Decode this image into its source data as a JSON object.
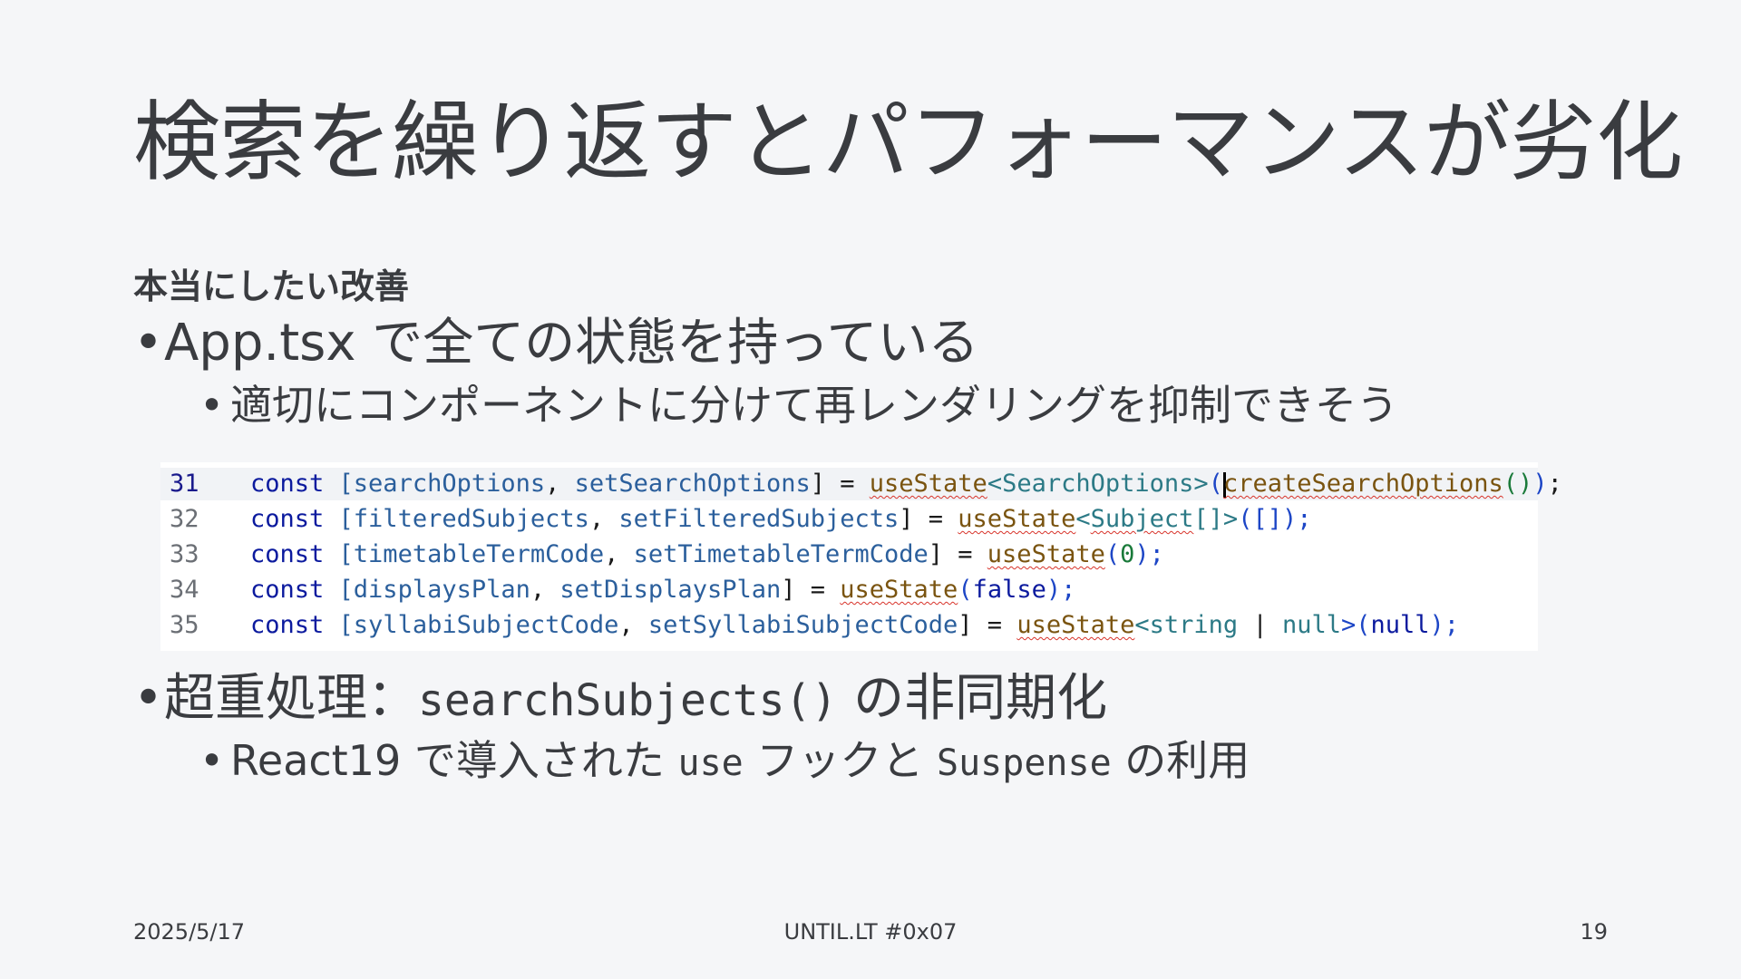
{
  "slide": {
    "title": "検索を繰り返すとパフォーマンスが劣化",
    "subtitle": "本当にしたい改善",
    "bullets": [
      {
        "text": "App.tsx で全ての状態を持っている",
        "sub": "適切にコンポーネントに分けて再レンダリングを抑制できそう"
      },
      {
        "text_before": "超重処理：",
        "code": "searchSubjects()",
        "text_after": " の非同期化",
        "sub_before": "React19 で導入された ",
        "sub_code1": "use",
        "sub_mid": " フックと ",
        "sub_code2": "Suspense",
        "sub_after": " の利用"
      }
    ]
  },
  "code": {
    "lines": [
      {
        "num": "31",
        "parts": [
          "const",
          " [",
          "searchOptions",
          ", ",
          "setSearchOptions",
          "] = ",
          "useState",
          "<",
          "SearchOptions",
          ">",
          "(",
          "createSearchOptions",
          "()",
          ")",
          ";"
        ]
      },
      {
        "num": "32",
        "parts": [
          "const",
          " [",
          "filteredSubjects",
          ", ",
          "setFilteredSubjects",
          "] = ",
          "useState",
          "<",
          "Subject",
          "[]>",
          "([]);"
        ]
      },
      {
        "num": "33",
        "parts": [
          "const",
          " [",
          "timetableTermCode",
          ", ",
          "setTimetableTermCode",
          "] = ",
          "useState",
          "(",
          "0",
          ");"
        ]
      },
      {
        "num": "34",
        "parts": [
          "const",
          " [",
          "displaysPlan",
          ", ",
          "setDisplaysPlan",
          "] = ",
          "useState",
          "(",
          "false",
          ");"
        ]
      },
      {
        "num": "35",
        "parts": [
          "const",
          " [",
          "syllabiSubjectCode",
          ", ",
          "setSyllabiSubjectCode",
          "] = ",
          "useState",
          "<",
          "string",
          " | ",
          "null",
          ">(",
          "null",
          ");"
        ]
      }
    ]
  },
  "footer": {
    "date": "2025/5/17",
    "event": "UNTIL.LT #0x07",
    "page": "19"
  },
  "colors": {
    "background": "#f5f6f8",
    "text": "#3a3c40",
    "keyword": "#0b1a9e",
    "function": "#7a5410",
    "type": "#2c7a86",
    "error_underline": "#d8332a"
  }
}
